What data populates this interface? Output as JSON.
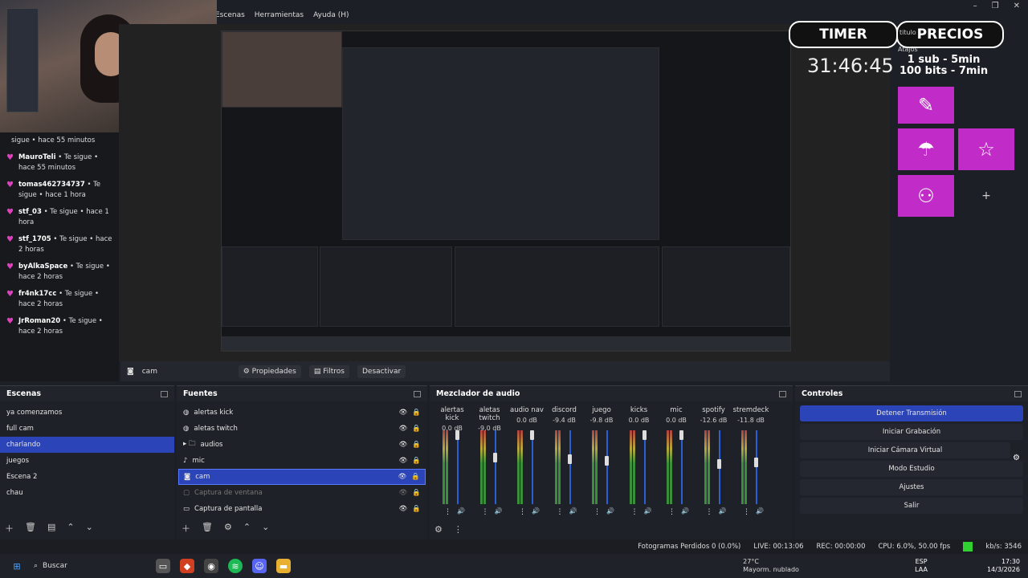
{
  "menu": [
    "Escenas",
    "Herramientas",
    "Ayuda (H)"
  ],
  "window_controls": [
    "–",
    "❐",
    "✕"
  ],
  "chat": [
    {
      "user": "",
      "text": "sigue • hace 55 minutos"
    },
    {
      "user": "MauroTeli",
      "text": "• Te sigue • hace 55 minutos"
    },
    {
      "user": "tomas462734737",
      "text": "• Te sigue • hace 1 hora"
    },
    {
      "user": "stf_03",
      "text": "• Te sigue • hace 1 hora"
    },
    {
      "user": "stf_1705",
      "text": "• Te sigue • hace 2 horas"
    },
    {
      "user": "byAlkaSpace",
      "text": "• Te sigue • hace 2 horas"
    },
    {
      "user": "fr4nk17cc",
      "text": "• Te sigue • hace 2 horas"
    },
    {
      "user": "JrRoman20",
      "text": "• Te sigue • hace 2 horas"
    }
  ],
  "overlay": {
    "timer_label": "TIMER",
    "prices_label": "PRECIOS",
    "titulo_peek": "titulo",
    "atajos": "Atajos",
    "timer_value": "31:46:45",
    "price_1": "1 sub - 5min",
    "price_2": "100 bits - 7min",
    "plus": "+"
  },
  "source_bar": {
    "source_name": "cam",
    "props_label": "Propiedades",
    "filters_label": "Filtros",
    "deactivate_label": "Desactivar"
  },
  "scenes": {
    "title": "Escenas",
    "items": [
      "ya comenzamos",
      "full cam",
      "charlando",
      "juegos",
      "Escena 2",
      "chau"
    ],
    "selected": 2
  },
  "sources": {
    "title": "Fuentes",
    "items": [
      {
        "name": "alertas kick",
        "icon": "globe-icon"
      },
      {
        "name": "aletas twitch",
        "icon": "globe-icon"
      },
      {
        "name": "audios",
        "icon": "folder-icon"
      },
      {
        "name": "mic",
        "icon": "mic-icon"
      },
      {
        "name": "cam",
        "icon": "camera-icon"
      },
      {
        "name": "Captura de ventana",
        "icon": "window-icon"
      },
      {
        "name": "Captura de pantalla",
        "icon": "monitor-icon"
      }
    ]
  },
  "mixer": {
    "title": "Mezclador de audio",
    "channels": [
      {
        "name": "alertas kick",
        "db": "0.0 dB",
        "level": 1.0
      },
      {
        "name": "aletas twitch",
        "db": "-9.0 dB",
        "level": 0.65
      },
      {
        "name": "audio nav",
        "db": "0.0 dB",
        "level": 1.0
      },
      {
        "name": "discord",
        "db": "-9.4 dB",
        "level": 0.62
      },
      {
        "name": "juego",
        "db": "-9.8 dB",
        "level": 0.6
      },
      {
        "name": "kicks",
        "db": "0.0 dB",
        "level": 1.0
      },
      {
        "name": "mic",
        "db": "0.0 dB",
        "level": 1.0
      },
      {
        "name": "spotify",
        "db": "-12.6 dB",
        "level": 0.55
      },
      {
        "name": "stremdeck",
        "db": "-11.8 dB",
        "level": 0.57
      }
    ]
  },
  "controls": {
    "title": "Controles",
    "buttons": [
      "Detener Transmisión",
      "Iniciar Grabación",
      "Iniciar Cámara Virtual",
      "Modo Estudio",
      "Ajustes",
      "Salir"
    ]
  },
  "status": {
    "dropped": "Fotogramas Perdidos 0 (0.0%)",
    "live": "LIVE: 00:13:06",
    "rec": "REC: 00:00:00",
    "cpu": "CPU: 6.0%, 50.00 fps",
    "kbs": "kb/s: 3546"
  },
  "taskbar": {
    "search_placeholder": "Buscar",
    "weather_temp": "27°C",
    "weather_desc": "Mayorm. nublado",
    "lang": "ESP",
    "lang2": "LAA",
    "time": "17:30",
    "date": "14/3/2026"
  },
  "colors": {
    "accent": "#2b44b8",
    "overlay_tile": "#c12cc9"
  }
}
